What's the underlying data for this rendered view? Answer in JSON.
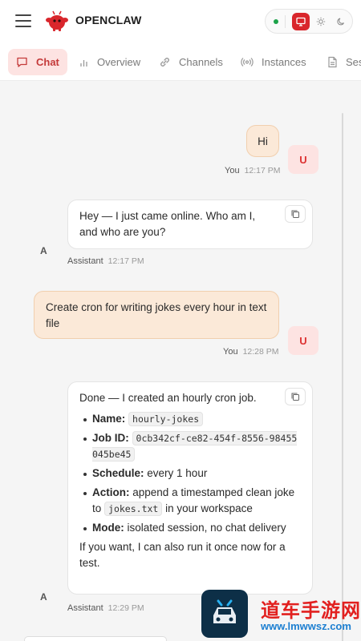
{
  "header": {
    "brand": "OPENCLAW",
    "status_color": "#1ca34a",
    "accent_color": "#d9262c",
    "theme_modes": [
      "system",
      "light",
      "dark"
    ],
    "active_theme": "system"
  },
  "tabs": [
    {
      "label": "Chat",
      "icon": "chat-icon",
      "active": true
    },
    {
      "label": "Overview",
      "icon": "bar-chart-icon",
      "active": false
    },
    {
      "label": "Channels",
      "icon": "link-icon",
      "active": false
    },
    {
      "label": "Instances",
      "icon": "broadcast-icon",
      "active": false
    },
    {
      "label": "Ses",
      "icon": "document-icon",
      "active": false
    }
  ],
  "messages": [
    {
      "role": "user",
      "avatar": "U",
      "text": "Hi",
      "sender": "You",
      "time": "12:17 PM"
    },
    {
      "role": "assistant",
      "avatar": "A",
      "text": "Hey — I just came online. Who am I, and who are you?",
      "sender": "Assistant",
      "time": "12:17 PM"
    },
    {
      "role": "user",
      "avatar": "U",
      "text": "Create cron for writing jokes every hour in text file",
      "sender": "You",
      "time": "12:28 PM"
    },
    {
      "role": "assistant",
      "avatar": "A",
      "sender": "Assistant",
      "time": "12:29 PM",
      "intro": "Done — I created an hourly cron job.",
      "details": {
        "name_label": "Name:",
        "name_value": "hourly-jokes",
        "jobid_label": "Job ID:",
        "jobid_value": "0cb342cf-ce82-454f-8556-98455045be45",
        "schedule_label": "Schedule:",
        "schedule_value": "every 1 hour",
        "action_label": "Action:",
        "action_pre": "append a timestamped clean joke to",
        "action_code": "jokes.txt",
        "action_post": "in your workspace",
        "mode_label": "Mode:",
        "mode_value": "isolated session, no chat delivery"
      },
      "outro": "If you want, I can also run it once now for a test."
    }
  ],
  "watermark": {
    "title": "道车手游网",
    "url": "www.lmwwsz.com"
  }
}
